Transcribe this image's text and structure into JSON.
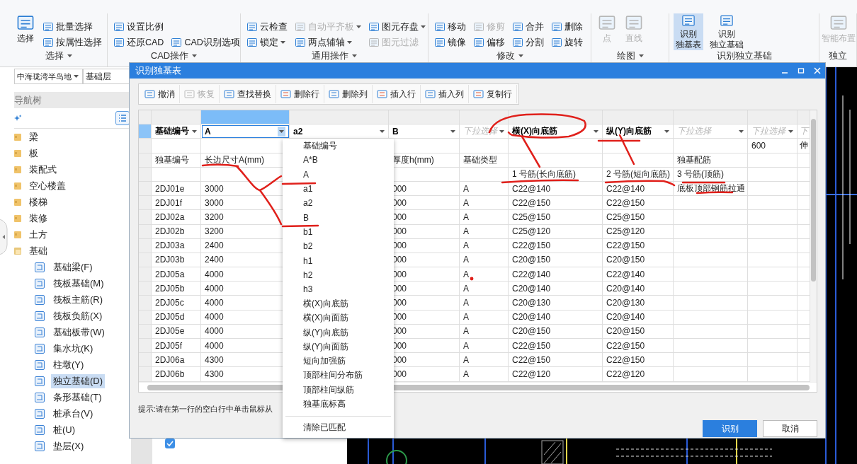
{
  "ribbon": {
    "groups": [
      {
        "label": "选择",
        "caret": true,
        "columns": [
          [
            {
              "label": "选择",
              "kind": "large",
              "disabled": false
            }
          ],
          [
            {
              "label": "批量选择",
              "kind": "button",
              "disabled": false
            },
            {
              "label": "按属性选择",
              "kind": "button",
              "disabled": false
            }
          ]
        ]
      },
      {
        "label": "CAD操作",
        "caret": true,
        "columns": [
          [
            {
              "label": "设置比例",
              "kind": "button",
              "disabled": false
            },
            {
              "label": "还原CAD",
              "kind": "button",
              "disabled": false
            }
          ],
          [
            {
              "label": "CAD识别选项",
              "kind": "button",
              "disabled": false
            }
          ]
        ]
      },
      {
        "label": "通用操作",
        "caret": true,
        "columns": [
          [
            {
              "label": "云检查",
              "kind": "button",
              "disabled": false
            },
            {
              "label": "锁定",
              "kind": "dropdown",
              "disabled": false
            }
          ],
          [
            {
              "label": "自动平齐板",
              "kind": "dropdown",
              "disabled": true
            },
            {
              "label": "两点辅轴",
              "kind": "dropdown",
              "disabled": false
            }
          ],
          [
            {
              "label": "图元存盘",
              "kind": "dropdown",
              "disabled": false
            },
            {
              "label": "图元过滤",
              "kind": "button",
              "disabled": true
            }
          ]
        ]
      },
      {
        "label": "修改",
        "caret": true,
        "columns": [
          [
            {
              "label": "移动",
              "kind": "button",
              "disabled": false
            },
            {
              "label": "镜像",
              "kind": "button",
              "disabled": false
            }
          ],
          [
            {
              "label": "修剪",
              "kind": "button",
              "disabled": true
            },
            {
              "label": "偏移",
              "kind": "button",
              "disabled": false
            }
          ],
          [
            {
              "label": "合并",
              "kind": "button",
              "disabled": false
            },
            {
              "label": "分割",
              "kind": "button",
              "disabled": false
            }
          ],
          [
            {
              "label": "删除",
              "kind": "button",
              "disabled": false
            },
            {
              "label": "旋转",
              "kind": "button",
              "disabled": false
            }
          ]
        ]
      },
      {
        "label": "绘图",
        "caret": true,
        "columns": [
          [
            {
              "label": "点",
              "kind": "large",
              "disabled": true
            }
          ],
          [
            {
              "label": "直线",
              "kind": "large",
              "disabled": true
            }
          ]
        ]
      },
      {
        "label": "识别独立基础",
        "caret": false,
        "columns": [
          [
            {
              "lines": [
                "识别",
                "独基表"
              ],
              "kind": "large",
              "disabled": false,
              "selected": true
            }
          ],
          [
            {
              "lines": [
                "识别",
                "独立基础"
              ],
              "kind": "large",
              "disabled": false,
              "selected": false
            }
          ]
        ]
      },
      {
        "label": "独立",
        "caret": false,
        "columns": [
          [
            {
              "label": "智能布置",
              "kind": "large",
              "disabled": true
            }
          ]
        ]
      }
    ]
  },
  "sidebar": {
    "project": "中海珑湾半岛地",
    "floor": "基础层",
    "title": "导航树",
    "items": [
      {
        "label": "梁",
        "expanded": false
      },
      {
        "label": "板",
        "expanded": false
      },
      {
        "label": "装配式",
        "expanded": false
      },
      {
        "label": "空心楼盖",
        "expanded": false
      },
      {
        "label": "楼梯",
        "expanded": false
      },
      {
        "label": "装修",
        "expanded": false
      },
      {
        "label": "土方",
        "expanded": false
      },
      {
        "label": "基础",
        "expanded": true,
        "children": [
          {
            "label": "基础梁(F)",
            "selected": false
          },
          {
            "label": "筏板基础(M)",
            "selected": false
          },
          {
            "label": "筏板主筋(R)",
            "selected": false
          },
          {
            "label": "筏板负筋(X)",
            "selected": false
          },
          {
            "label": "基础板带(W)",
            "selected": false
          },
          {
            "label": "集水坑(K)",
            "selected": false
          },
          {
            "label": "柱墩(Y)",
            "selected": false
          },
          {
            "label": "独立基础(D)",
            "selected": true
          },
          {
            "label": "条形基础(T)",
            "selected": false
          },
          {
            "label": "桩承台(V)",
            "selected": false
          },
          {
            "label": "桩(U)",
            "selected": false
          },
          {
            "label": "垫层(X)",
            "selected": false
          }
        ]
      }
    ]
  },
  "layers": [
    {
      "checked": true
    }
  ],
  "dialog": {
    "title": "识别独基表",
    "toolbar": [
      {
        "label": "撤消",
        "disabled": false
      },
      {
        "label": "恢复",
        "disabled": true
      },
      {
        "label": "查找替换",
        "disabled": false
      },
      {
        "label": "删除行",
        "disabled": false
      },
      {
        "label": "删除列",
        "disabled": false
      },
      {
        "label": "插入行",
        "disabled": false
      },
      {
        "label": "插入列",
        "disabled": false
      },
      {
        "label": "复制行",
        "disabled": false
      }
    ],
    "mapping": [
      {
        "value": "基础编号",
        "selected": false
      },
      {
        "value": "A",
        "selected": true
      },
      {
        "value": "a2",
        "selected": false
      },
      {
        "value": "B",
        "selected": false
      },
      {
        "placeholder": "下拉选择",
        "selected": false
      },
      {
        "value": "横(X)向底筋",
        "selected": false
      },
      {
        "value": "纵(Y)向底筋",
        "selected": false
      },
      {
        "placeholder": "下拉选择",
        "selected": false
      },
      {
        "placeholder": "下拉选择",
        "selected": false
      },
      {
        "placeholder": "下",
        "selected": false
      }
    ],
    "rows": [
      [
        null,
        null,
        null,
        null,
        null,
        null,
        null,
        null,
        "600",
        "伸"
      ],
      [
        "独基编号",
        "长边尺寸A(mm)",
        null,
        "厚度h(mm)",
        "基础类型",
        null,
        null,
        "独基配筋",
        null,
        null
      ],
      [
        null,
        null,
        null,
        null,
        null,
        "1 号筋(长向底筋)",
        "2 号筋(短向底筋)",
        "3 号筋(顶筋)",
        null,
        null
      ],
      [
        "2DJ01e",
        "3000",
        null,
        "000",
        "A",
        "C22@140",
        "C22@140",
        "底板顶部钢筋拉通",
        null,
        null
      ],
      [
        "2DJ01f",
        "3000",
        null,
        "000",
        "A",
        "C22@150",
        "C22@150",
        null,
        null,
        null
      ],
      [
        "2DJ02a",
        "3200",
        null,
        "000",
        "A",
        "C25@150",
        "C25@150",
        null,
        null,
        null
      ],
      [
        "2DJ02b",
        "3200",
        null,
        "000",
        "A",
        "C25@120",
        "C25@120",
        null,
        null,
        null
      ],
      [
        "2DJ03a",
        "2400",
        null,
        "000",
        "A",
        "C22@150",
        "C22@150",
        null,
        null,
        null
      ],
      [
        "2DJ03b",
        "2400",
        null,
        "000",
        "A",
        "C20@150",
        "C20@150",
        null,
        null,
        null
      ],
      [
        "2DJ05a",
        "4000",
        null,
        "000",
        "A",
        "C22@140",
        "C22@140",
        null,
        null,
        null
      ],
      [
        "2DJ05b",
        "4000",
        null,
        "000",
        "A",
        "C20@140",
        "C20@140",
        null,
        null,
        null
      ],
      [
        "2DJ05c",
        "4000",
        null,
        "000",
        "A",
        "C20@130",
        "C20@130",
        null,
        null,
        null
      ],
      [
        "2DJ05d",
        "4000",
        null,
        "000",
        "A",
        "C20@140",
        "C20@140",
        null,
        null,
        null
      ],
      [
        "2DJ05e",
        "4000",
        null,
        "000",
        "A",
        "C20@150",
        "C20@150",
        null,
        null,
        null
      ],
      [
        "2DJ05f",
        "4000",
        null,
        "000",
        "A",
        "C22@150",
        "C22@150",
        null,
        null,
        null
      ],
      [
        "2DJ06a",
        "4300",
        null,
        "000",
        "A",
        "C22@150",
        "C22@150",
        null,
        null,
        null
      ],
      [
        "2DJ06b",
        "4300",
        null,
        "000",
        "A",
        "C22@120",
        "C22@120",
        null,
        null,
        null
      ]
    ],
    "menu": [
      {
        "label": "基础编号",
        "kind": "item"
      },
      {
        "label": "A*B",
        "kind": "item"
      },
      {
        "label": "A",
        "kind": "item"
      },
      {
        "label": "a1",
        "kind": "item"
      },
      {
        "label": "a2",
        "kind": "item"
      },
      {
        "label": "B",
        "kind": "item"
      },
      {
        "label": "b1",
        "kind": "item"
      },
      {
        "label": "b2",
        "kind": "item"
      },
      {
        "label": "h1",
        "kind": "item"
      },
      {
        "label": "h2",
        "kind": "item"
      },
      {
        "label": "h3",
        "kind": "item"
      },
      {
        "label": "横(X)向底筋",
        "kind": "item"
      },
      {
        "label": "横(X)向面筋",
        "kind": "item"
      },
      {
        "label": "纵(Y)向底筋",
        "kind": "item"
      },
      {
        "label": "纵(Y)向面筋",
        "kind": "item"
      },
      {
        "label": "短向加强筋",
        "kind": "item"
      },
      {
        "label": "顶部柱间分布筋",
        "kind": "item"
      },
      {
        "label": "顶部柱间纵筋",
        "kind": "item"
      },
      {
        "label": "独基底标高",
        "kind": "item"
      },
      {
        "kind": "separator"
      },
      {
        "label": "清除已匹配",
        "kind": "item"
      }
    ],
    "hint": "提示:请在第一行的空白行中单击鼠标从",
    "buttons": [
      {
        "label": "识别",
        "kind": "primary"
      },
      {
        "label": "取消",
        "kind": "secondary"
      }
    ]
  }
}
